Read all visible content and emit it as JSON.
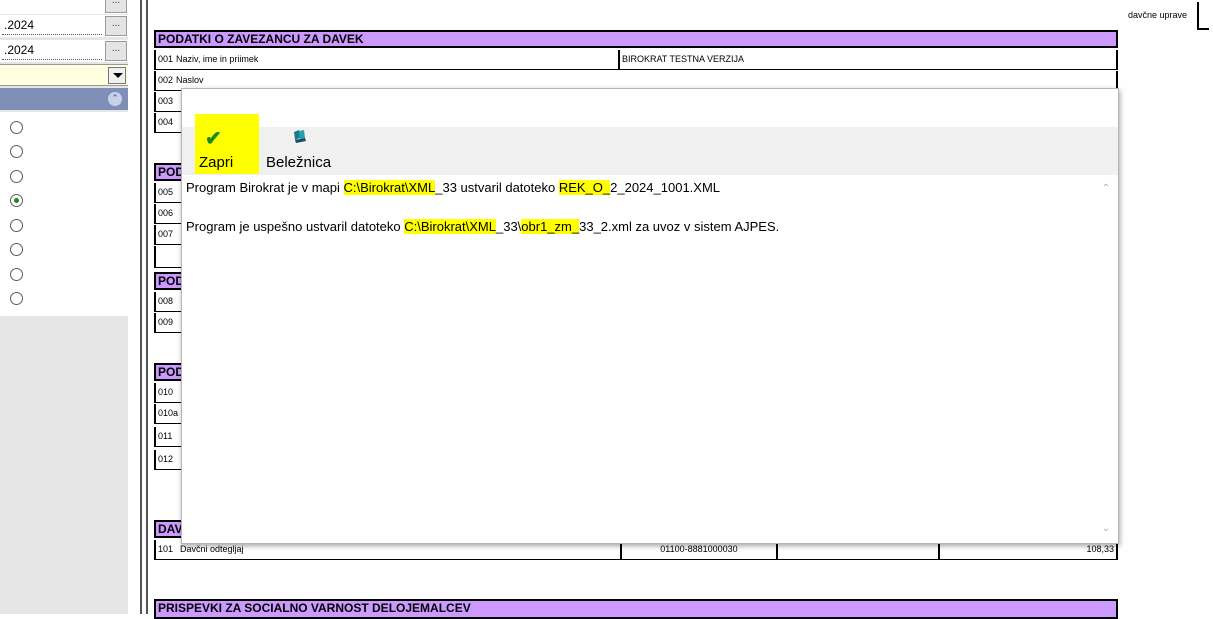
{
  "left_panel": {
    "dates": [
      ".2024",
      ".2024"
    ],
    "dots_label": "...",
    "radio_count": 8
  },
  "form": {
    "tax_office_label": "davčne uprave",
    "section_payer_title": "PODATKI O ZAVEZANCU ZA DAVEK",
    "rows_payer": [
      {
        "code": "001",
        "label": "Naziv, ime in priimek",
        "value": "BIROKRAT TESTNA VERZIJA"
      },
      {
        "code": "002",
        "label": "Naslov",
        "value": ""
      },
      {
        "code": "003",
        "label": "",
        "value": ""
      },
      {
        "code": "004",
        "label": "",
        "value": ""
      }
    ],
    "section_2_title": "POD",
    "rows_2": [
      "005",
      "006",
      "007"
    ],
    "section_3_title": "POD",
    "rows_3": [
      "008",
      "009"
    ],
    "section_4_title": "POD",
    "rows_4": [
      "010",
      "010a",
      "011",
      "012"
    ],
    "section_tax_title": "DAV",
    "tax_row": {
      "code": "101",
      "label": "Davčni odtegljaj",
      "account": "01100-8881000030",
      "amount": "108,33"
    },
    "section_contrib_title": "PRISPEVKI ZA SOCIALNO VARNOST DELOJEMALCEV"
  },
  "dialog": {
    "toolbar": {
      "close_label": "Zapri",
      "notepad_label": "Beležnica"
    },
    "message1": {
      "prefix": "Program Birokrat je v mapi ",
      "path_hl": "C:\\Birokrat\\XML",
      "mid": "_33 ustvaril datoteko ",
      "file_hl": "REK_O_",
      "suffix": "2_2024_1001.XML"
    },
    "message2": {
      "prefix": "Program je uspešno ustvaril datoteko ",
      "path_hl": "C:\\Birokrat\\XML",
      "mid": "_33\\",
      "file_hl": "obr1_zm_",
      "suffix": "33_2.xml za uvoz v sistem AJPES."
    }
  },
  "colors": {
    "section_header": "#cc99ff",
    "highlight": "#ffff00",
    "group_header": "#7f8fb8",
    "combo_bg": "#ffffe0"
  }
}
